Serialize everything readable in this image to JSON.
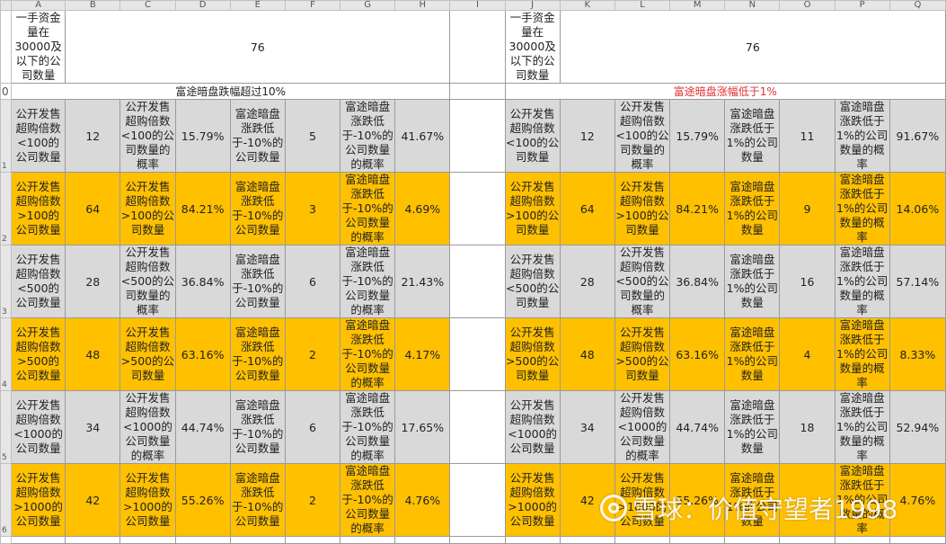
{
  "columns": [
    "A",
    "B",
    "C",
    "D",
    "E",
    "F",
    "G",
    "H",
    "I",
    "J",
    "K",
    "L",
    "M",
    "N",
    "O",
    "P",
    "Q"
  ],
  "row_numbers": [
    "0",
    "1",
    "2",
    "3",
    "4",
    "5",
    "6"
  ],
  "header_block": {
    "label": "一手资金量在30000及以下的公司数量",
    "left_value": "76",
    "right_value": "76"
  },
  "section_titles": {
    "left": "富途暗盘跌幅超过10%",
    "right": "富途暗盘涨幅低于1%"
  },
  "colors": {
    "gray_row": "#d9d9d9",
    "gold_row": "#ffc000",
    "right_title": "#e03030"
  },
  "rows": [
    {
      "style": "gray",
      "left": [
        "公开发售超购倍数<100的公司数量",
        "12",
        "公开发售超购倍数<100的公司数量的概率",
        "15.79%",
        "富途暗盘涨跌低于-10%的公司数量",
        "5",
        "富途暗盘涨跌低于-10%的公司数量的概率",
        "41.67%"
      ],
      "right": [
        "公开发售超购倍数<100的公司数量",
        "12",
        "公开发售超购倍数<100的公司数量的概率",
        "15.79%",
        "富途暗盘涨跌低于1%的公司数量",
        "11",
        "富途暗盘涨跌低于1%的公司数量的概率",
        "91.67%"
      ]
    },
    {
      "style": "gold",
      "left": [
        "公开发售超购倍数>100的公司数量",
        "64",
        "公开发售超购倍数>100的公司数量",
        "84.21%",
        "富途暗盘涨跌低于-10%的公司数量",
        "3",
        "富途暗盘涨跌低于-10%的公司数量的概率",
        "4.69%"
      ],
      "right": [
        "公开发售超购倍数>100的公司数量",
        "64",
        "公开发售超购倍数>100的公司数量",
        "84.21%",
        "富途暗盘涨跌低于1%的公司数量",
        "9",
        "富途暗盘涨跌低于1%的公司数量的概率",
        "14.06%"
      ]
    },
    {
      "style": "gray",
      "left": [
        "公开发售超购倍数<500的公司数量",
        "28",
        "公开发售超购倍数<500的公司数量的概率",
        "36.84%",
        "富途暗盘涨跌低于-10%的公司数量",
        "6",
        "富途暗盘涨跌低于-10%的公司数量的概率",
        "21.43%"
      ],
      "right": [
        "公开发售超购倍数<500的公司数量",
        "28",
        "公开发售超购倍数<500的公司数量的概率",
        "36.84%",
        "富途暗盘涨跌低于1%的公司数量",
        "16",
        "富途暗盘涨跌低于1%的公司数量的概率",
        "57.14%"
      ]
    },
    {
      "style": "gold",
      "left": [
        "公开发售超购倍数>500的公司数量",
        "48",
        "公开发售超购倍数>500的公司数量",
        "63.16%",
        "富途暗盘涨跌低于-10%的公司数量",
        "2",
        "富途暗盘涨跌低于-10%的公司数量的概率",
        "4.17%"
      ],
      "right": [
        "公开发售超购倍数>500的公司数量",
        "48",
        "公开发售超购倍数>500的公司数量",
        "63.16%",
        "富途暗盘涨跌低于1%的公司数量",
        "4",
        "富途暗盘涨跌低于1%的公司数量的概率",
        "8.33%"
      ]
    },
    {
      "style": "gray",
      "left": [
        "公开发售超购倍数<1000的公司数量",
        "34",
        "公开发售超购倍数<1000的公司数量的概率",
        "44.74%",
        "富途暗盘涨跌低于-10%的公司数量",
        "6",
        "富途暗盘涨跌低于-10%的公司数量的概率",
        "17.65%"
      ],
      "right": [
        "公开发售超购倍数<1000的公司数量",
        "34",
        "公开发售超购倍数<1000的公司数量的概率",
        "44.74%",
        "富途暗盘涨跌低于1%的公司数量",
        "18",
        "富途暗盘涨跌低于1%的公司数量的概率",
        "52.94%"
      ]
    },
    {
      "style": "gold",
      "left": [
        "公开发售超购倍数>1000的公司数量",
        "42",
        "公开发售超购倍数>1000的公司数量",
        "55.26%",
        "富途暗盘涨跌低于-10%的公司数量",
        "2",
        "富途暗盘涨跌低于-10%的公司数量的概率",
        "4.76%"
      ],
      "right": [
        "公开发售超购倍数>1000的公司数量",
        "42",
        "公开发售超购倍数>1000的公司数量",
        "55.26%",
        "富途暗盘涨跌低于1%的公司数量",
        "",
        "富途暗盘涨跌低于1%的公司数量的概率",
        "4.76%"
      ]
    }
  ],
  "watermark": {
    "text": "雪球：价值守望者1998",
    "icon": "snowball-logo-icon"
  }
}
